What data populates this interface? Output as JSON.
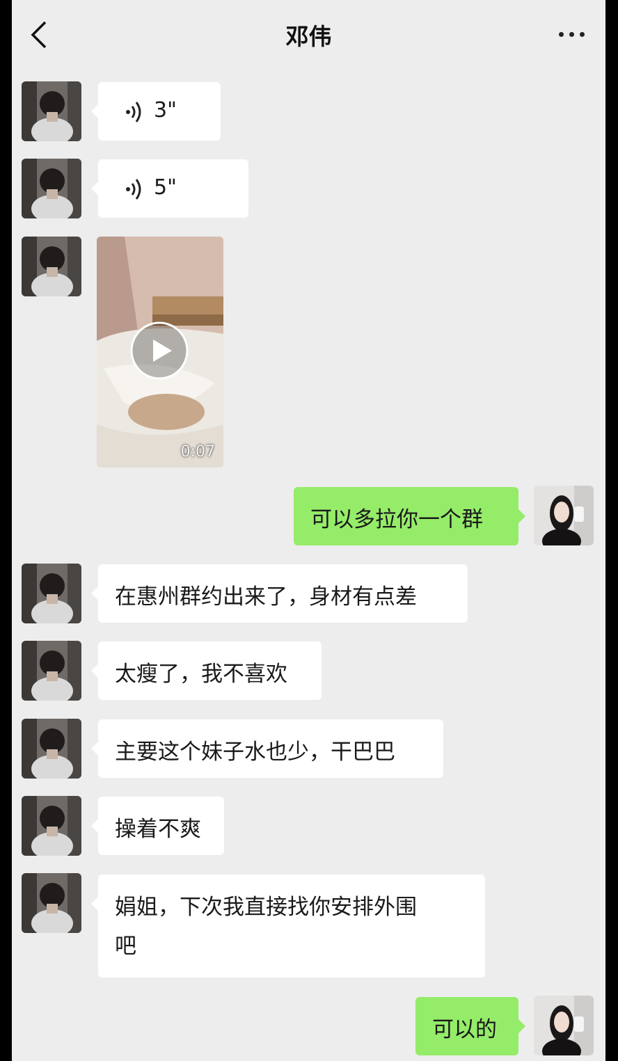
{
  "header": {
    "title": "邓伟",
    "back_icon": "chevron-left-icon",
    "more_icon": "more-dots-icon"
  },
  "messages": [
    {
      "from": "contact",
      "type": "voice",
      "duration": "3\""
    },
    {
      "from": "contact",
      "type": "voice",
      "duration": "5\""
    },
    {
      "from": "contact",
      "type": "video",
      "duration": "0:07"
    },
    {
      "from": "me",
      "type": "text",
      "text": "可以多拉你一个群"
    },
    {
      "from": "contact",
      "type": "text",
      "text": "在惠州群约出来了，身材有点差"
    },
    {
      "from": "contact",
      "type": "text",
      "text": "太瘦了，我不喜欢"
    },
    {
      "from": "contact",
      "type": "text",
      "text": "主要这个妹子水也少，干巴巴"
    },
    {
      "from": "contact",
      "type": "text",
      "text": "操着不爽"
    },
    {
      "from": "contact",
      "type": "text",
      "text_line1": "娟姐，下次我直接找你安排外围",
      "text_line2": "吧"
    },
    {
      "from": "me",
      "type": "text",
      "text": "可以的"
    }
  ],
  "colors": {
    "background": "#ededed",
    "incoming_bubble": "#ffffff",
    "outgoing_bubble": "#95ec69"
  }
}
